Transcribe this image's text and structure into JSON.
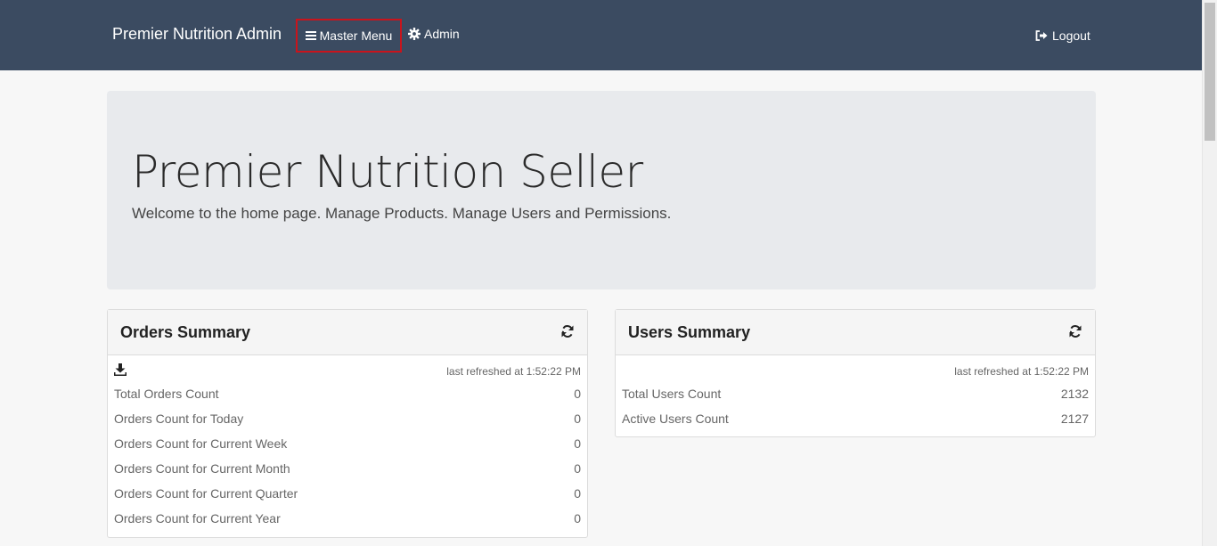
{
  "nav": {
    "brand": "Premier Nutrition Admin",
    "master_menu": "Master Menu",
    "admin": "Admin",
    "logout": "Logout"
  },
  "jumbotron": {
    "title": "Premier Nutrition Seller",
    "subtitle": "Welcome to the home page. Manage Products. Manage Users and Permissions."
  },
  "orders": {
    "title": "Orders Summary",
    "refreshed": "last refreshed at 1:52:22 PM",
    "rows": [
      {
        "label": "Total Orders Count",
        "value": "0"
      },
      {
        "label": "Orders Count for Today",
        "value": "0"
      },
      {
        "label": "Orders Count for Current Week",
        "value": "0"
      },
      {
        "label": "Orders Count for Current Month",
        "value": "0"
      },
      {
        "label": "Orders Count for Current Quarter",
        "value": "0"
      },
      {
        "label": "Orders Count for Current Year",
        "value": "0"
      }
    ]
  },
  "users": {
    "title": "Users Summary",
    "refreshed": "last refreshed at 1:52:22 PM",
    "rows": [
      {
        "label": "Total Users Count",
        "value": "2132"
      },
      {
        "label": "Active Users Count",
        "value": "2127"
      }
    ]
  },
  "icons": {
    "menu": "hamburger-icon",
    "admin": "gear-icon",
    "logout": "sign-out-icon",
    "refresh": "refresh-icon",
    "download": "download-icon"
  },
  "colors": {
    "navbar": "#3b4b61",
    "highlight": "#c9141c",
    "jumbotron": "#e8eaed"
  }
}
